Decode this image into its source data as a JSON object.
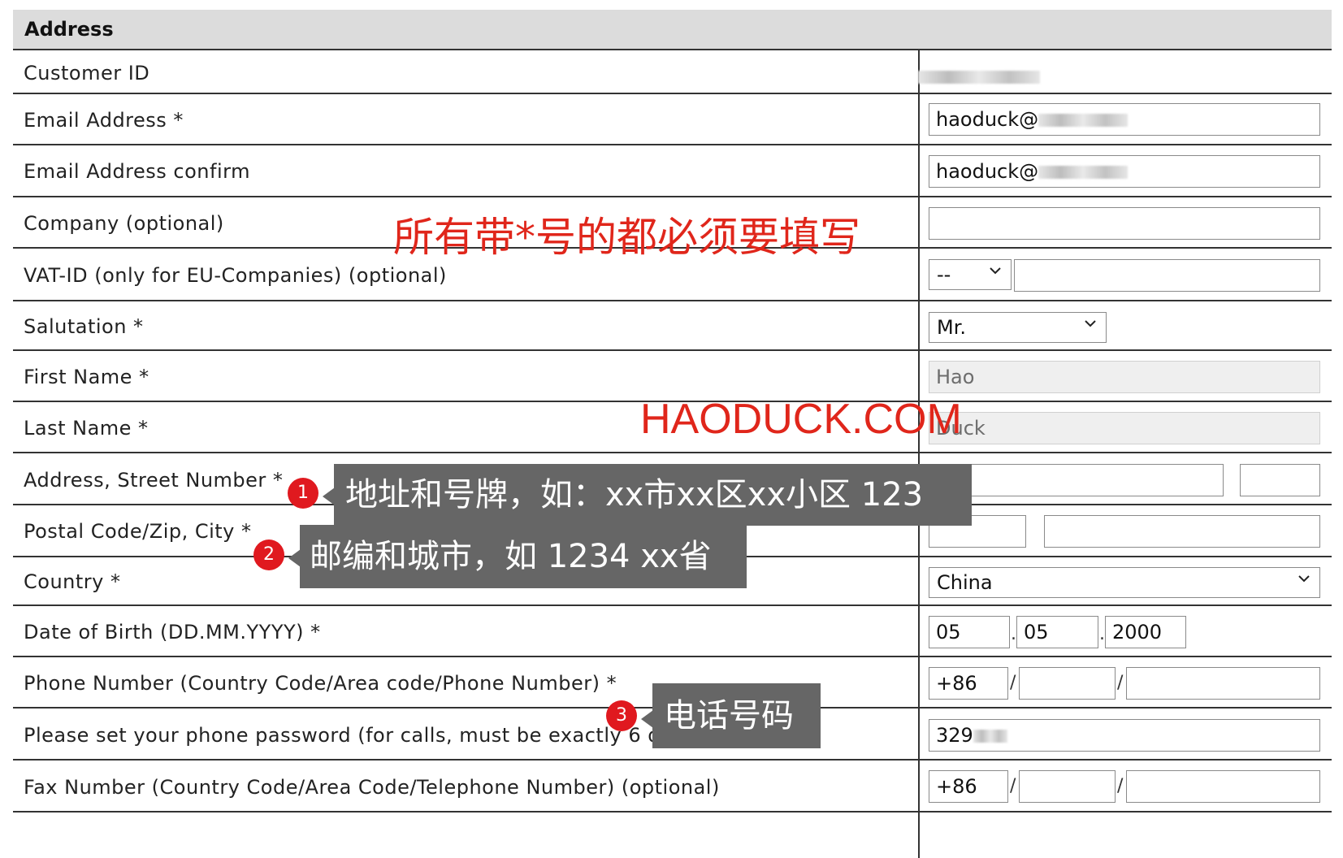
{
  "section": {
    "title": "Address"
  },
  "rows": [
    {
      "label": "Customer ID"
    },
    {
      "label": "Email Address *"
    },
    {
      "label": "Email Address confirm"
    },
    {
      "label": "Company (optional)"
    },
    {
      "label": "VAT-ID (only for EU-Companies) (optional)"
    },
    {
      "label": "Salutation *"
    },
    {
      "label": "First Name *"
    },
    {
      "label": "Last Name *"
    },
    {
      "label": "Address, Street Number *"
    },
    {
      "label": "Postal Code/Zip, City *"
    },
    {
      "label": "Country *"
    },
    {
      "label": "Date of Birth (DD.MM.YYYY) *"
    },
    {
      "label": "Phone Number (Country Code/Area code/Phone Number) *"
    },
    {
      "label": "Please set your phone password (for calls, must be exactly 6 digits) *"
    },
    {
      "label": "Fax Number (Country Code/Area Code/Telephone Number) (optional)"
    }
  ],
  "fields": {
    "email": "haoduck@",
    "email_confirm": "haoduck@",
    "company": "",
    "vat_prefix": "--",
    "vat_id": "",
    "salutation": "Mr.",
    "first_name": "Hao",
    "last_name": "Duck",
    "street": "",
    "street_number": "",
    "postal_code": "",
    "city": "",
    "country": "China",
    "dob_day": "05",
    "dob_month": "05",
    "dob_year": "2000",
    "phone_country": "+86",
    "phone_area": "",
    "phone_number": "",
    "phone_password": "329",
    "fax_country": "+86",
    "fax_area": "",
    "fax_number": ""
  },
  "separators": {
    "dot": ".",
    "slash": "/"
  },
  "annotations": {
    "required_note": "所有带*号的都必须要填写",
    "watermark": "HAODUCK.COM",
    "callouts": [
      {
        "badge": "1",
        "text": "地址和号牌，如：xx市xx区xx小区  123"
      },
      {
        "badge": "2",
        "text": "邮编和城市，如 1234 xx省"
      },
      {
        "badge": "3",
        "text": "电话号码"
      }
    ]
  },
  "colors": {
    "header_bg": "#dcdcdc",
    "annotation_red": "#e0261b",
    "callout_bg": "#666666",
    "badge_red": "#e0191f"
  }
}
